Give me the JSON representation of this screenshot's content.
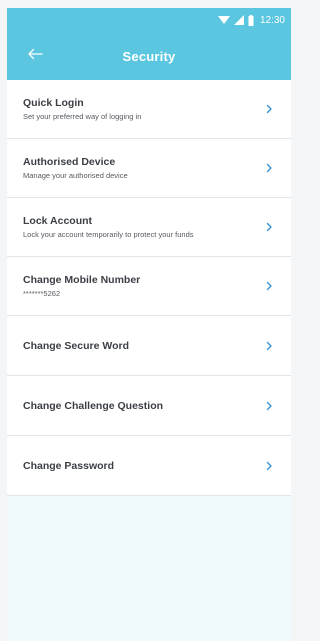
{
  "status_bar": {
    "time": "12:30",
    "icons": [
      "wifi-icon",
      "signal-icon",
      "battery-icon"
    ]
  },
  "header": {
    "title": "Security",
    "back_icon": "arrow-left-icon"
  },
  "menu": {
    "items": [
      {
        "title": "Quick Login",
        "subtitle": "Set your preferred way of logging in"
      },
      {
        "title": "Authorised Device",
        "subtitle": "Manage your authorised device"
      },
      {
        "title": "Lock Account",
        "subtitle": "Lock your account temporarily to protect your funds"
      },
      {
        "title": "Change Mobile Number",
        "subtitle": "*******5262"
      },
      {
        "title": "Change Secure Word",
        "subtitle": ""
      },
      {
        "title": "Change Challenge Question",
        "subtitle": ""
      },
      {
        "title": "Change Password",
        "subtitle": ""
      }
    ]
  },
  "colors": {
    "accent": "#5bc6df",
    "chevron": "#2f8fd0",
    "background": "#f0f9fc"
  }
}
